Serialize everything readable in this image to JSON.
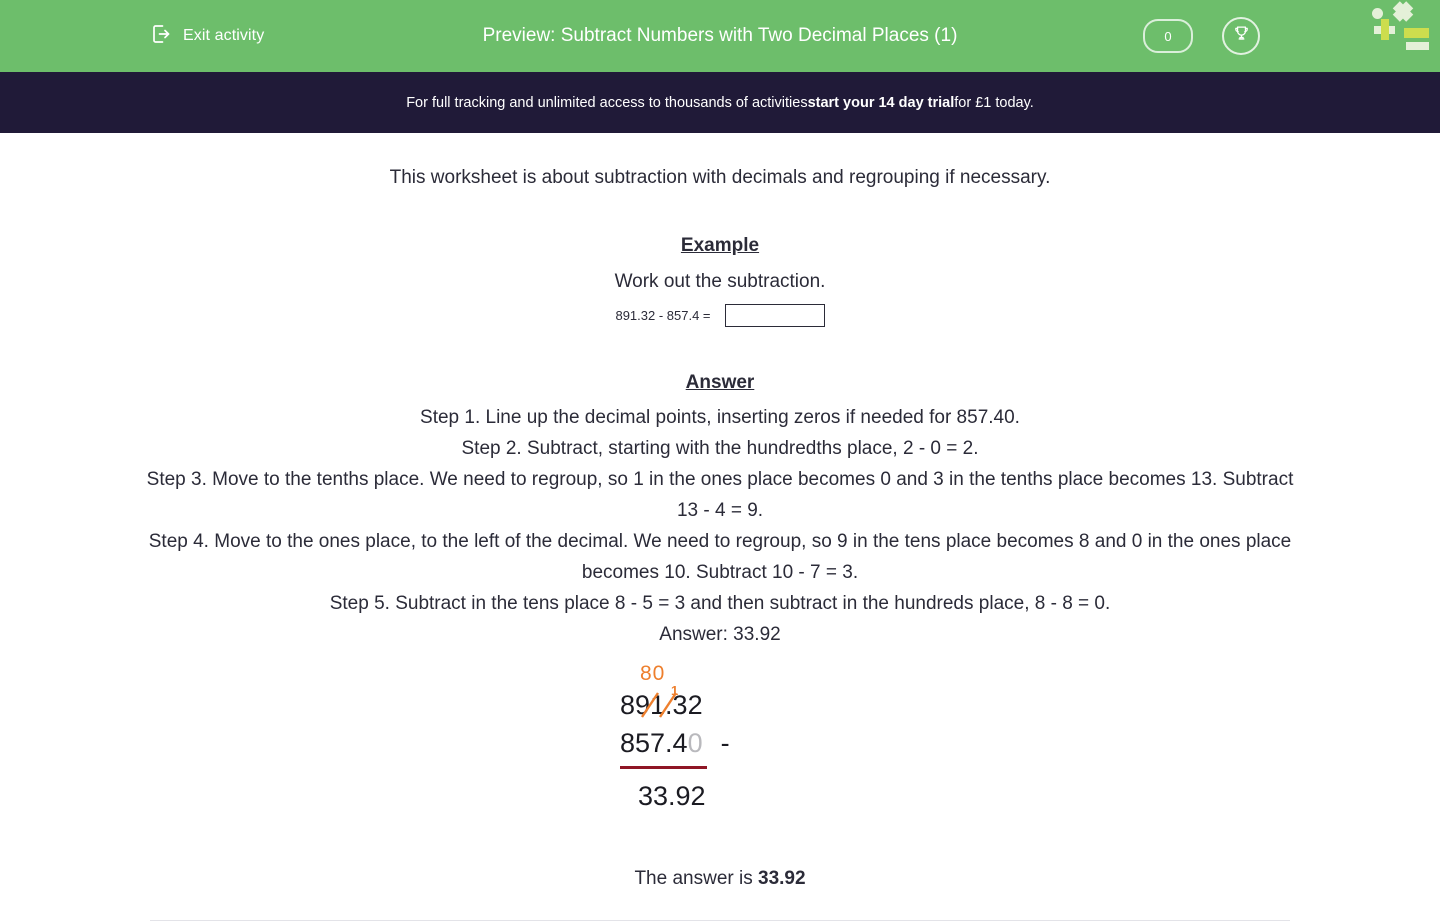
{
  "topbar": {
    "exit_label": "Exit activity",
    "exit_icon": "exit-arrow-icon",
    "title": "Preview: Subtract Numbers with Two Decimal Places (1)",
    "score_value": "0",
    "trophy_icon": "trophy-icon",
    "brand_icon": "brand-logo",
    "background_color": "#6dbe6b"
  },
  "promo": {
    "text_before": "For full tracking and unlimited access to thousands of activities ",
    "text_bold": "start your 14 day trial",
    "text_after": " for £1 today.",
    "background_color": "#201a38"
  },
  "worksheet": {
    "intro": "This worksheet is about subtraction with decimals and regrouping if necessary.",
    "example_heading": "Example",
    "instruction": "Work out the subtraction.",
    "question_text": "891.32 - 857.4 =",
    "answer_input_value": "",
    "answer_input_placeholder": "",
    "answer_heading": "Answer",
    "steps": [
      "Step 1. Line up the decimal points, inserting zeros if needed for 857.40.",
      "Step 2. Subtract, starting with the hundredths place, 2 - 0 = 2.",
      "Step 3. Move to the tenths place. We need to regroup, so 1 in the ones place becomes 0 and 3 in the tenths place becomes 13. Subtract 13 - 4 = 9.",
      "Step 4. Move to the ones place, to the left of the decimal. We need to regroup, so 9 in the tens place becomes 8 and 0 in the ones place becomes 10. Subtract 10 - 7 = 3.",
      "Step 5. Subtract in the tens place 8 - 5 = 3 and then subtract in the hundreds place, 8 - 8 = 0.",
      "Answer: 33.92"
    ],
    "column_sum": {
      "regroup_marks": "80",
      "carry_digit": "1",
      "minuend": "891.32",
      "subtrahend_main": "857.4",
      "subtrahend_ghost_zero": "0",
      "operator": "-",
      "result": "33.92",
      "regroup_color": "#ee7f2d",
      "rule_color": "#8f1625",
      "ghost_zero_color": "#b9b9bd"
    },
    "final_answer_label": "The answer is ",
    "final_answer_value": "33.92"
  }
}
